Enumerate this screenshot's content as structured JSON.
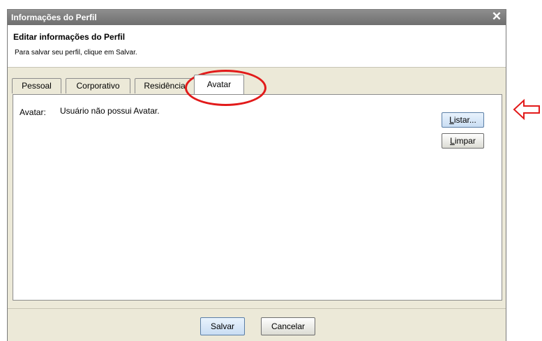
{
  "window": {
    "title": "Informações do Perfil",
    "close_glyph": "✕"
  },
  "header": {
    "title": "Editar informações do Perfil",
    "subtitle": "Para salvar seu perfil, clique em Salvar."
  },
  "tabs": [
    {
      "label": "Pessoal",
      "active": false
    },
    {
      "label": "Corporativo",
      "active": false
    },
    {
      "label": "Residência",
      "active": false
    },
    {
      "label": "Avatar",
      "active": true
    }
  ],
  "avatar_panel": {
    "label": "Avatar:",
    "status": "Usuário não possui Avatar.",
    "list_button": {
      "mnemonic": "L",
      "rest": "istar..."
    },
    "clear_button": {
      "mnemonic": "L",
      "rest": "impar"
    }
  },
  "footer": {
    "save_label": "Salvar",
    "cancel_label": "Cancelar"
  },
  "annotations": {
    "highlight_color": "#e21a1a",
    "arrow_icon": "left-arrow-outline-icon"
  }
}
